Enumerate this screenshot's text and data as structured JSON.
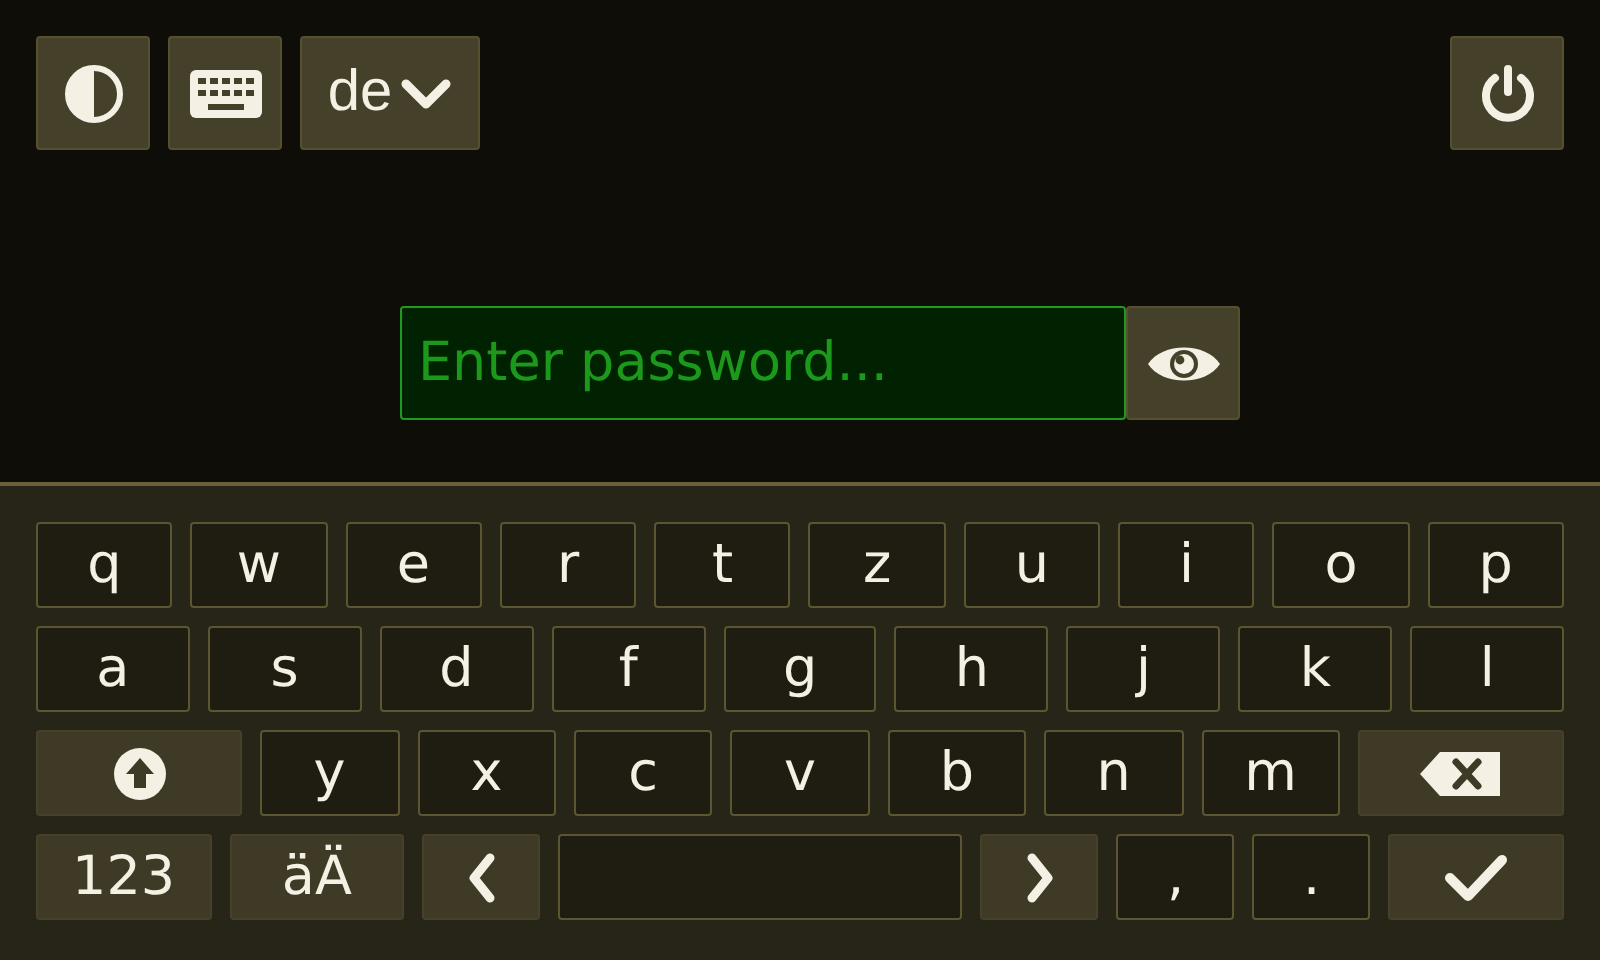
{
  "language": {
    "label": "de"
  },
  "password": {
    "placeholder": "Enter password..."
  },
  "keyboard": {
    "rows": [
      {
        "keys": [
          {
            "kind": "char",
            "label": "q"
          },
          {
            "kind": "char",
            "label": "w"
          },
          {
            "kind": "char",
            "label": "e"
          },
          {
            "kind": "char",
            "label": "r"
          },
          {
            "kind": "char",
            "label": "t"
          },
          {
            "kind": "char",
            "label": "z"
          },
          {
            "kind": "char",
            "label": "u"
          },
          {
            "kind": "char",
            "label": "i"
          },
          {
            "kind": "char",
            "label": "o"
          },
          {
            "kind": "char",
            "label": "p"
          }
        ]
      },
      {
        "keys": [
          {
            "kind": "char",
            "label": "a"
          },
          {
            "kind": "char",
            "label": "s"
          },
          {
            "kind": "char",
            "label": "d"
          },
          {
            "kind": "char",
            "label": "f"
          },
          {
            "kind": "char",
            "label": "g"
          },
          {
            "kind": "char",
            "label": "h"
          },
          {
            "kind": "char",
            "label": "j"
          },
          {
            "kind": "char",
            "label": "k"
          },
          {
            "kind": "char",
            "label": "l"
          }
        ]
      },
      {
        "keys": [
          {
            "kind": "shift"
          },
          {
            "kind": "char",
            "label": "y"
          },
          {
            "kind": "char",
            "label": "x"
          },
          {
            "kind": "char",
            "label": "c"
          },
          {
            "kind": "char",
            "label": "v"
          },
          {
            "kind": "char",
            "label": "b"
          },
          {
            "kind": "char",
            "label": "n"
          },
          {
            "kind": "char",
            "label": "m"
          },
          {
            "kind": "backspace"
          }
        ]
      },
      {
        "keys": [
          {
            "kind": "mode",
            "label": "123"
          },
          {
            "kind": "mode",
            "label": "äÄ"
          },
          {
            "kind": "left"
          },
          {
            "kind": "space"
          },
          {
            "kind": "right"
          },
          {
            "kind": "char",
            "label": ","
          },
          {
            "kind": "char",
            "label": "."
          },
          {
            "kind": "enter"
          }
        ]
      }
    ]
  }
}
